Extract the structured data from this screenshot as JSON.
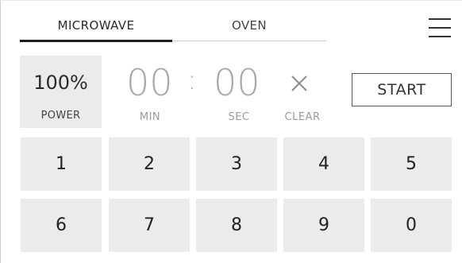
{
  "tabs": [
    {
      "label": "MICROWAVE",
      "active": true
    },
    {
      "label": "OVEN",
      "active": false
    }
  ],
  "menu_icon": "hamburger-menu-icon",
  "power": {
    "value": "100%",
    "label": "POWER"
  },
  "timer": {
    "minutes": "00",
    "separator": ":",
    "seconds": "00",
    "min_label": "MIN",
    "sec_label": "SEC"
  },
  "clear": {
    "label": "CLEAR",
    "icon": "close-icon"
  },
  "start_label": "START",
  "keypad": [
    "1",
    "2",
    "3",
    "4",
    "5",
    "6",
    "7",
    "8",
    "9",
    "0"
  ],
  "colors": {
    "key_bg": "#ebebeb",
    "timer_digits": "#a9a9a9",
    "active_tab_underline": "#1e1e1e"
  }
}
